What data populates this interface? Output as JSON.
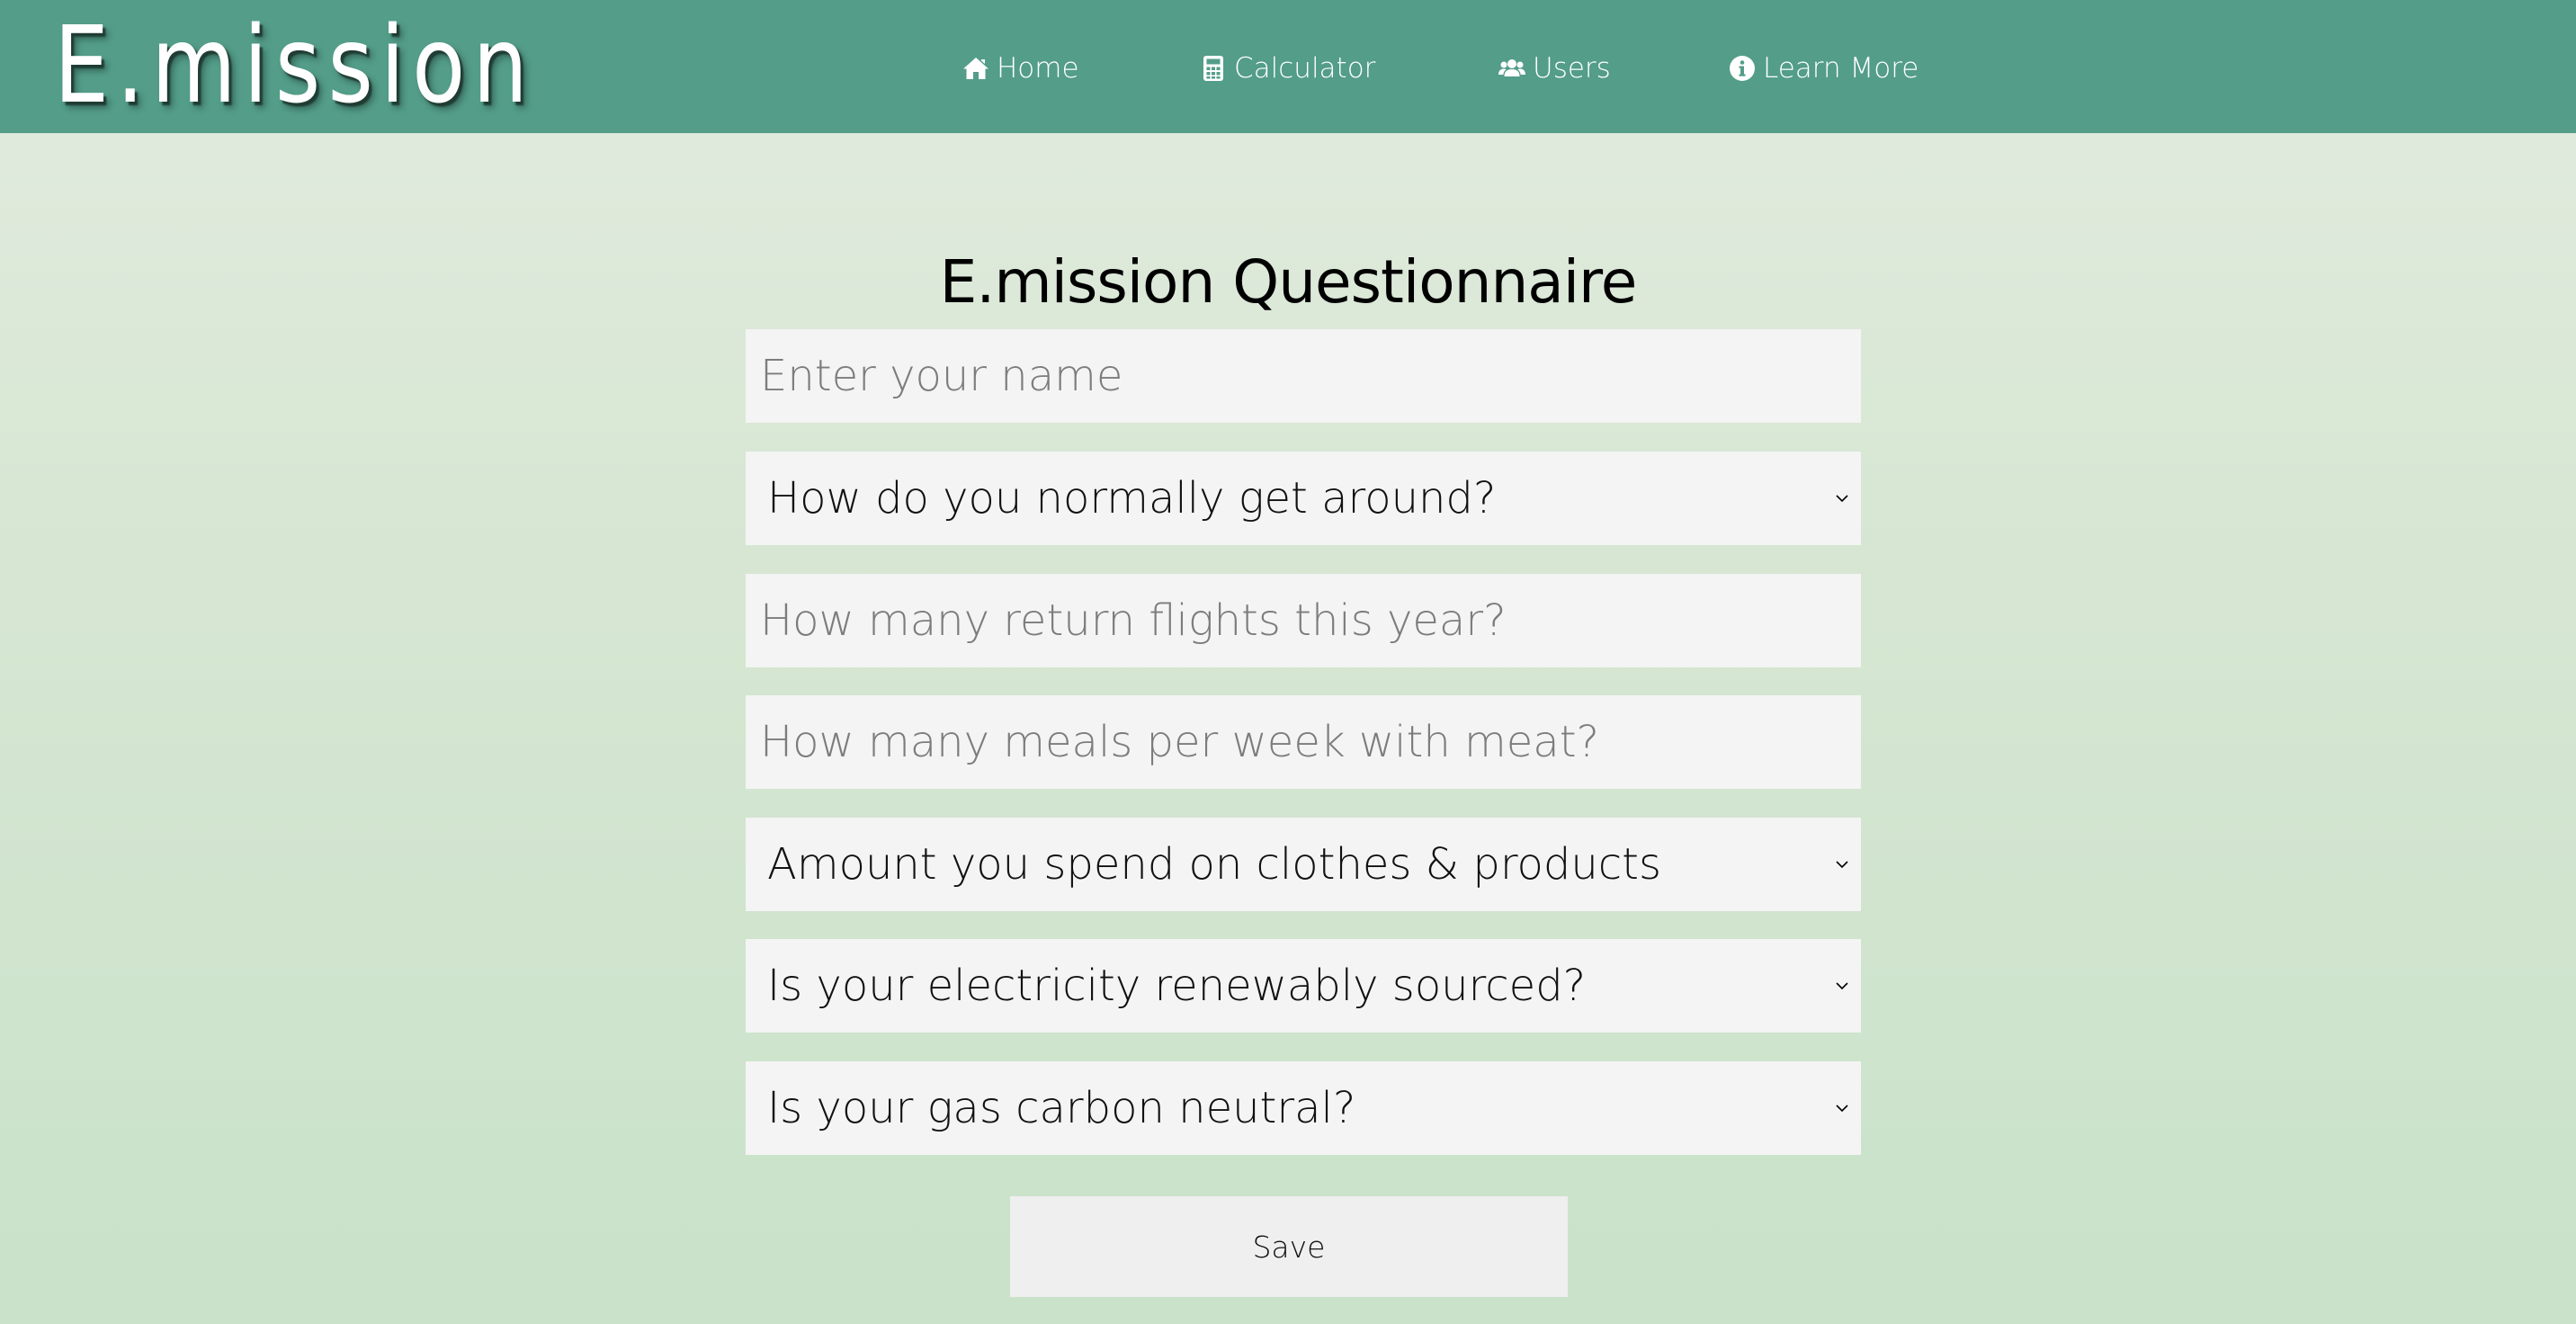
{
  "header": {
    "logo": "E.mission",
    "nav": [
      {
        "label": "Home",
        "icon": "home-icon"
      },
      {
        "label": "Calculator",
        "icon": "calculator-icon"
      },
      {
        "label": "Users",
        "icon": "users-icon"
      },
      {
        "label": "Learn More",
        "icon": "info-circle-icon"
      }
    ],
    "background_color": "#539d89"
  },
  "main": {
    "title": "E.mission Questionnaire",
    "name_field": {
      "placeholder": "Enter your name",
      "value": ""
    },
    "transport_select": {
      "selected": "How do you normally get around?"
    },
    "flights_field": {
      "placeholder": "How many return flights this year?",
      "value": ""
    },
    "meat_field": {
      "placeholder": "How many meals per week with meat?",
      "value": ""
    },
    "spending_select": {
      "selected": "Amount you spend on clothes & products"
    },
    "electricity_select": {
      "selected": "Is your electricity renewably sourced?"
    },
    "gas_select": {
      "selected": "Is your gas carbon neutral?"
    },
    "save_label": "Save"
  }
}
